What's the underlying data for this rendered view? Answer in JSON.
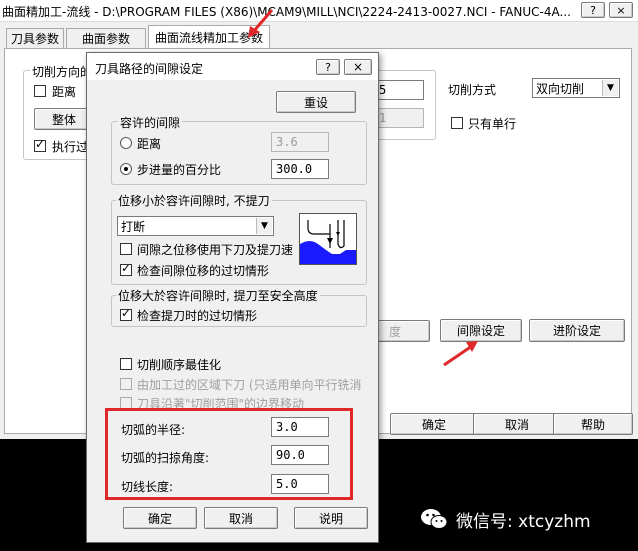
{
  "main_window": {
    "title": "曲面精加工-流线 - D:\\PROGRAM FILES (X86)\\MCAM9\\MILL\\NCI\\2224-2413-0027.NCI - FANUC-4A...",
    "tabs": [
      "刀具参数",
      "曲面参数",
      "曲面流线精加工参数"
    ],
    "cut_direction_group": "切削方向的",
    "distance_checkbox": "距离",
    "whole_button": "整体",
    "execute_checkbox": "执行过",
    "field_value_5": "5",
    "field_value_1": "1",
    "cut_mode_label": "切削方式",
    "cut_mode_value": "双向切削",
    "single_row_checkbox": "只有单行",
    "partial_button": "度",
    "gap_settings_button": "间隙设定",
    "advanced_settings_button": "进阶设定",
    "ok_button": "确定",
    "cancel_button": "取消",
    "help_button": "帮助"
  },
  "dialog": {
    "title": "刀具路径的间隙设定",
    "help_btn": "?",
    "close_btn": "×",
    "reset_button": "重设",
    "tolerance_group": {
      "title": "容许的间隙",
      "distance_label": "距离",
      "distance_value": "3.6",
      "step_pct_label": "步进量的百分比",
      "step_pct_value": "300.0"
    },
    "small_move_group": {
      "title": "位移小於容许间隙时, 不提刀",
      "dropdown_value": "打断",
      "checkbox1": "间隙之位移使用下刀及提刀速",
      "checkbox2": "检查间隙位移的过切情形"
    },
    "large_move_group": {
      "title": "位移大於容许间隙时, 提刀至安全高度",
      "checkbox1": "检查提刀时的过切情形"
    },
    "optimize_checkbox": "切削顺序最佳化",
    "machined_area_checkbox": "由加工过的区域下刀 (只适用单向平行铣消",
    "boundary_checkbox": "刀具沿著\"切削范围\"的边界移动",
    "arc_radius_label": "切弧的半径:",
    "arc_radius_value": "3.0",
    "arc_sweep_label": "切弧的扫掠角度:",
    "arc_sweep_value": "90.0",
    "line_length_label": "切线长度:",
    "line_length_value": "5.0",
    "ok_button": "确定",
    "cancel_button": "取消",
    "explain_button": "说明"
  },
  "watermark": {
    "text": "微信号: xtcyzhm"
  },
  "colors": {
    "highlight_box": "#e0282a",
    "arrow": "#e0282a",
    "background": "#000000",
    "dialog_bg": "#f0f0f0",
    "title_bar": "#ffffff"
  }
}
